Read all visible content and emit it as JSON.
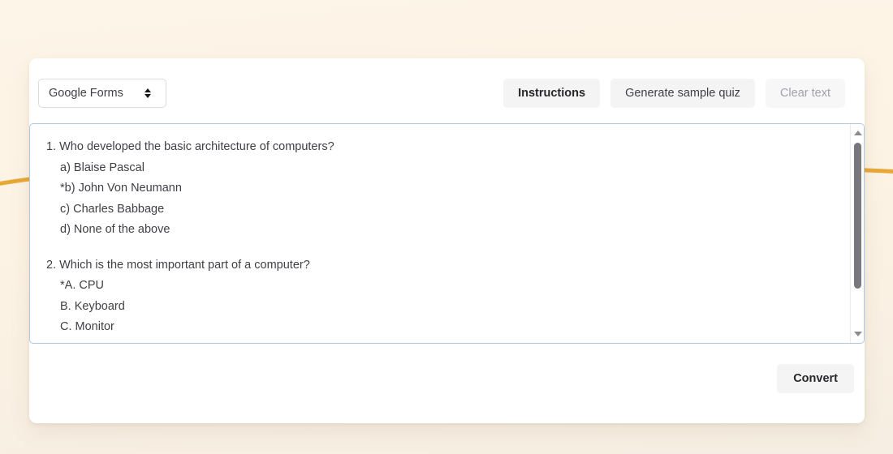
{
  "background": {
    "color": "#fdf4e6",
    "accent_curve_color": "#e8a838"
  },
  "toolbar": {
    "format_select": {
      "selected": "Google Forms",
      "options": [
        "Google Forms"
      ]
    },
    "buttons": [
      {
        "label": "Instructions",
        "state": "emphasis"
      },
      {
        "label": "Generate sample quiz",
        "state": "normal"
      },
      {
        "label": "Clear text",
        "state": "disabled"
      }
    ]
  },
  "editor": {
    "questions": [
      {
        "prompt": "1. Who developed the basic architecture of computers?",
        "options": [
          "a) Blaise Pascal",
          "*b) John Von Neumann",
          "c) Charles Babbage",
          "d) None of the above"
        ]
      },
      {
        "prompt": "2. Which is the most important part of a computer?",
        "options": [
          "*A. CPU",
          "B. Keyboard",
          "C. Monitor"
        ]
      }
    ],
    "scrollbar": {
      "up_arrow": "scroll-up-icon",
      "down_arrow": "scroll-down-icon",
      "thumb_position": "top"
    }
  },
  "footer": {
    "convert_label": "Convert"
  }
}
